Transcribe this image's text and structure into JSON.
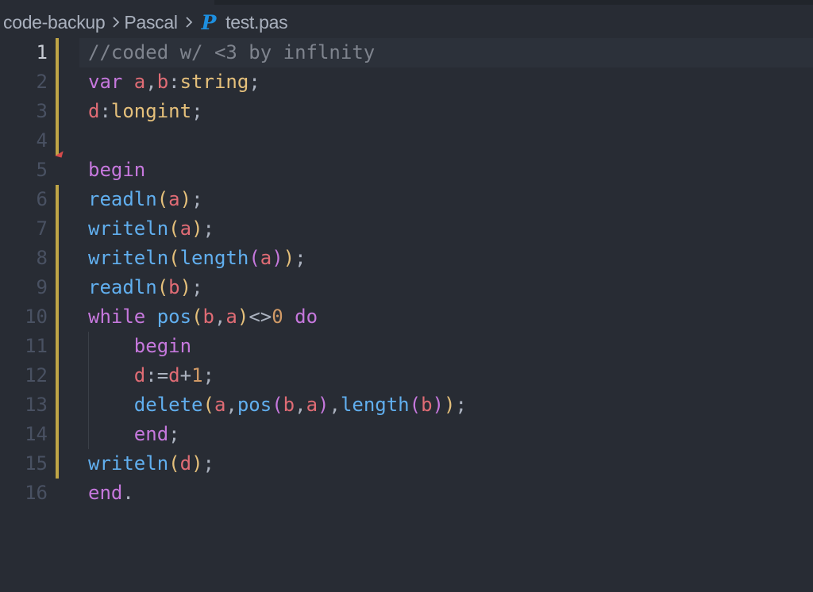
{
  "breadcrumb": {
    "folder": "code-backup",
    "subfolder": "Pascal",
    "file_icon": "pascal-file-icon",
    "file_icon_glyph": "P",
    "file": "test.pas"
  },
  "editor": {
    "active_line": 1,
    "lines": [
      {
        "num": "1",
        "t": [
          [
            "//coded w/ <3 by inflnity",
            "cmt"
          ]
        ]
      },
      {
        "num": "2",
        "t": [
          [
            "var ",
            "kw"
          ],
          [
            "a",
            "var"
          ],
          [
            ",",
            "op"
          ],
          [
            "b",
            "var"
          ],
          [
            ":",
            "op"
          ],
          [
            "string",
            "typ"
          ],
          [
            ";",
            "op"
          ]
        ]
      },
      {
        "num": "3",
        "t": [
          [
            "d",
            "var"
          ],
          [
            ":",
            "op"
          ],
          [
            "longint",
            "typ"
          ],
          [
            ";",
            "op"
          ]
        ]
      },
      {
        "num": "4",
        "t": []
      },
      {
        "num": "5",
        "t": [
          [
            "begin",
            "kw"
          ]
        ]
      },
      {
        "num": "6",
        "t": [
          [
            "readln",
            "fn"
          ],
          [
            "(",
            "p1"
          ],
          [
            "a",
            "var"
          ],
          [
            ")",
            "p1"
          ],
          [
            ";",
            "op"
          ]
        ]
      },
      {
        "num": "7",
        "t": [
          [
            "writeln",
            "fn"
          ],
          [
            "(",
            "p1"
          ],
          [
            "a",
            "var"
          ],
          [
            ")",
            "p1"
          ],
          [
            ";",
            "op"
          ]
        ]
      },
      {
        "num": "8",
        "t": [
          [
            "writeln",
            "fn"
          ],
          [
            "(",
            "p1"
          ],
          [
            "length",
            "fn"
          ],
          [
            "(",
            "p2"
          ],
          [
            "a",
            "var"
          ],
          [
            ")",
            "p2"
          ],
          [
            ")",
            "p1"
          ],
          [
            ";",
            "op"
          ]
        ]
      },
      {
        "num": "9",
        "t": [
          [
            "readln",
            "fn"
          ],
          [
            "(",
            "p1"
          ],
          [
            "b",
            "var"
          ],
          [
            ")",
            "p1"
          ],
          [
            ";",
            "op"
          ]
        ]
      },
      {
        "num": "10",
        "t": [
          [
            "while ",
            "kw"
          ],
          [
            "pos",
            "fn"
          ],
          [
            "(",
            "p1"
          ],
          [
            "b",
            "var"
          ],
          [
            ",",
            "op"
          ],
          [
            "a",
            "var"
          ],
          [
            ")",
            "p1"
          ],
          [
            "<>",
            "op"
          ],
          [
            "0",
            "num"
          ],
          [
            " do",
            "kw"
          ]
        ]
      },
      {
        "num": "11",
        "t": [
          [
            "    ",
            "op"
          ],
          [
            "begin",
            "kw"
          ]
        ]
      },
      {
        "num": "12",
        "t": [
          [
            "    ",
            "op"
          ],
          [
            "d",
            "var"
          ],
          [
            ":=",
            "op"
          ],
          [
            "d",
            "var"
          ],
          [
            "+",
            "op"
          ],
          [
            "1",
            "num"
          ],
          [
            ";",
            "op"
          ]
        ]
      },
      {
        "num": "13",
        "t": [
          [
            "    ",
            "op"
          ],
          [
            "delete",
            "fn"
          ],
          [
            "(",
            "p1"
          ],
          [
            "a",
            "var"
          ],
          [
            ",",
            "op"
          ],
          [
            "pos",
            "fn"
          ],
          [
            "(",
            "p2"
          ],
          [
            "b",
            "var"
          ],
          [
            ",",
            "op"
          ],
          [
            "a",
            "var"
          ],
          [
            ")",
            "p2"
          ],
          [
            ",",
            "op"
          ],
          [
            "length",
            "fn"
          ],
          [
            "(",
            "p2"
          ],
          [
            "b",
            "var"
          ],
          [
            ")",
            "p2"
          ],
          [
            ")",
            "p1"
          ],
          [
            ";",
            "op"
          ]
        ]
      },
      {
        "num": "14",
        "t": [
          [
            "    ",
            "op"
          ],
          [
            "end",
            "kw"
          ],
          [
            ";",
            "op"
          ]
        ]
      },
      {
        "num": "15",
        "t": [
          [
            "writeln",
            "fn"
          ],
          [
            "(",
            "p1"
          ],
          [
            "d",
            "var"
          ],
          [
            ")",
            "p1"
          ],
          [
            ";",
            "op"
          ]
        ]
      },
      {
        "num": "16",
        "t": [
          [
            "end",
            "kw"
          ],
          [
            ".",
            "op"
          ]
        ]
      }
    ],
    "modified_lines": [
      "1",
      "2",
      "3",
      "4",
      "6",
      "7",
      "8",
      "9",
      "10",
      "11",
      "12",
      "13",
      "14",
      "15"
    ],
    "deleted_marker_after_line": "4",
    "indent_guide_lines": [
      "11",
      "12",
      "13",
      "14"
    ]
  },
  "colors": {
    "background": "#282c34",
    "keyword": "#c678dd",
    "variable": "#e06c75",
    "type": "#e5c07b",
    "function": "#61afef",
    "number": "#d19a66",
    "comment": "#7f848e",
    "gutter_modified": "#bfa546"
  }
}
